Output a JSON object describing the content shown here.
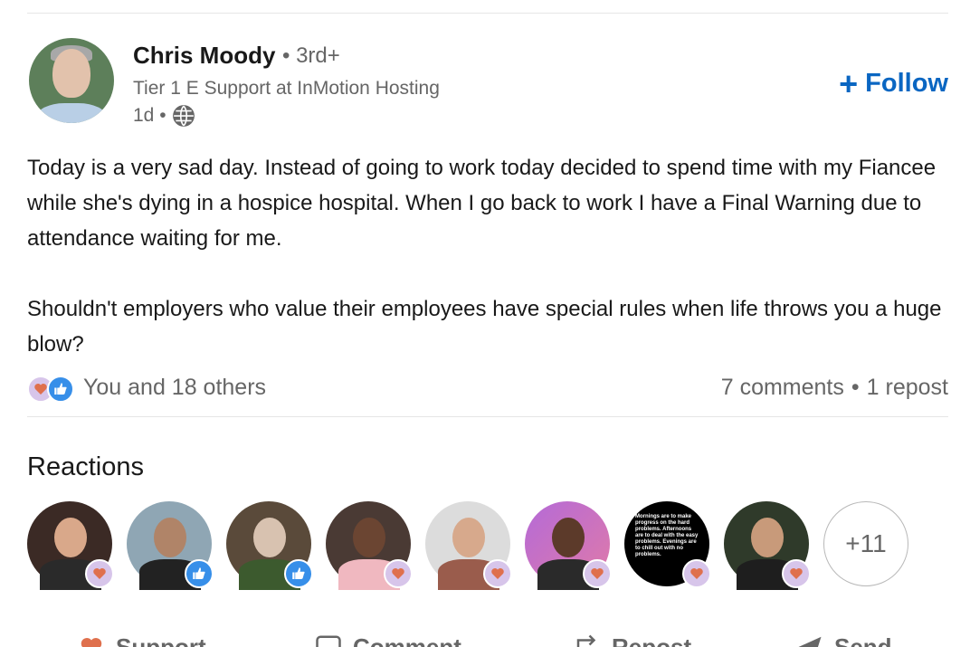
{
  "post": {
    "author_name": "Chris Moody",
    "degree": "• 3rd+",
    "headline": "Tier 1 E Support at InMotion Hosting",
    "time": "1d •",
    "follow_label": "Follow",
    "text": "Today is a very sad day. Instead of going to work today decided to spend time with my Fiancee while she's dying in a hospice hospital. When I go back to work I have a Final Warning due to attendance waiting for me.\n\nShouldn't employers who value their employees have special rules when life throws you a huge blow?"
  },
  "social": {
    "reactors_text": "You and 18 others",
    "comments": "7 comments",
    "separator": "•",
    "reposts": "1 repost"
  },
  "reactions": {
    "title": "Reactions",
    "more": "+11",
    "image_text": "Mornings are to make progress on the hard problems. Afternoons are to deal with the easy problems. Evenings are to chill out with no problems."
  },
  "actions": {
    "support": "Support",
    "comment": "Comment",
    "repost": "Repost",
    "send": "Send"
  },
  "colors": {
    "accent": "#0a66c2",
    "support_badge": "#d7c5ea",
    "like_badge": "#378fe9"
  }
}
